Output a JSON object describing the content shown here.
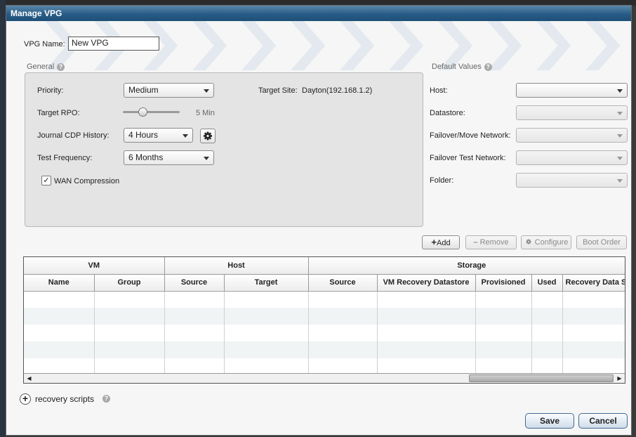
{
  "dialog": {
    "title": "Manage VPG"
  },
  "vpg_name": {
    "label": "VPG Name:",
    "value": "New VPG"
  },
  "general": {
    "header": "General",
    "help": "?",
    "priority": {
      "label": "Priority:",
      "value": "Medium"
    },
    "target_site": {
      "label": "Target Site:",
      "value": "Dayton(192.168.1.2)"
    },
    "target_rpo": {
      "label": "Target RPO:",
      "value_text": "5 Min",
      "slider_fraction": 0.33
    },
    "journal": {
      "label": "Journal CDP History:",
      "value": "4 Hours"
    },
    "test_frequency": {
      "label": "Test Frequency:",
      "value": "6 Months"
    },
    "wan_compression": {
      "label": "WAN Compression",
      "checked": true,
      "mark": "✓"
    }
  },
  "defaults": {
    "header": "Default Values",
    "help": "?",
    "host": {
      "label": "Host:",
      "value": ""
    },
    "datastore": {
      "label": "Datastore:",
      "value": ""
    },
    "failover_network": {
      "label": "Failover/Move Network:",
      "value": ""
    },
    "failover_test_network": {
      "label": "Failover Test Network:",
      "value": ""
    },
    "folder": {
      "label": "Folder:",
      "value": ""
    }
  },
  "toolbar": {
    "add": "Add",
    "add_glyph": "+",
    "remove": "Remove",
    "remove_glyph": "–",
    "configure": "Configure",
    "boot_order": "Boot Order"
  },
  "table": {
    "groups": [
      "VM",
      "Host",
      "Storage"
    ],
    "columns": [
      "Name",
      "Group",
      "Source",
      "Target",
      "Source",
      "VM Recovery Datastore",
      "Provisioned",
      "Used",
      "Recovery Data Size"
    ],
    "rows": [],
    "scroll_left": "◀",
    "scroll_right": "▶"
  },
  "recovery_scripts": {
    "label": "recovery scripts",
    "glyph": "+",
    "help": "?"
  },
  "footer": {
    "save": "Save",
    "cancel": "Cancel"
  },
  "colors": {
    "title_bar": "#285c86",
    "accent_border": "#42698f"
  }
}
